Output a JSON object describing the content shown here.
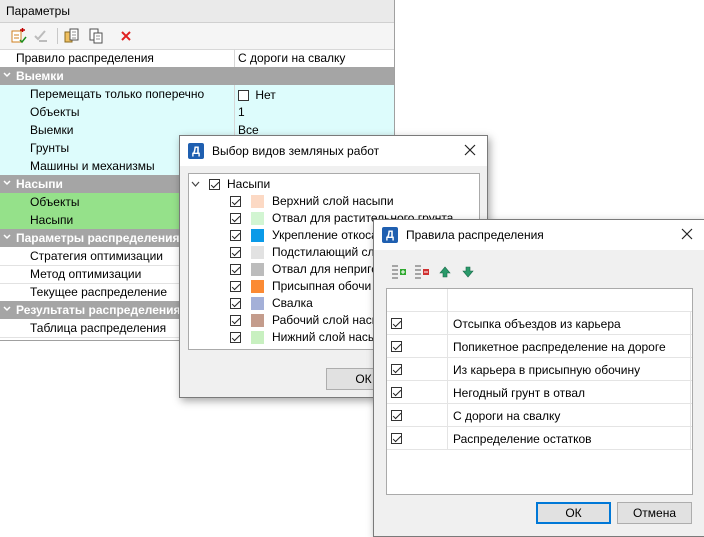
{
  "params": {
    "title": "Параметры",
    "toolbar": {
      "icons": [
        "add-rule-icon",
        "check-rule-icon",
        "copy-icon",
        "paste-icon",
        "delete-icon"
      ],
      "delete_color": "#e02020"
    },
    "top_row": {
      "name": "Правило распределения",
      "value": "С дороги на свалку"
    },
    "sections": [
      {
        "title": "Выемки",
        "rows": [
          {
            "name": "Перемещать только поперечно",
            "value": "Нет",
            "checkbox": true,
            "checked": false
          },
          {
            "name": "Объекты",
            "value": "1"
          },
          {
            "name": "Выемки",
            "value": "Все"
          },
          {
            "name": "Грунты",
            "value": ""
          },
          {
            "name": "Машины и механизмы",
            "value": ""
          }
        ]
      },
      {
        "title": "Насыпи",
        "rows": [
          {
            "name": "Объекты",
            "value": ""
          },
          {
            "name": "Насыпи",
            "value": ""
          }
        ]
      },
      {
        "title": "Параметры распределения",
        "rows": [
          {
            "name": "Стратегия оптимизации",
            "value": ""
          },
          {
            "name": "Метод оптимизации",
            "value": ""
          },
          {
            "name": "Текущее распределение",
            "value": ""
          }
        ]
      },
      {
        "title": "Результаты распределения",
        "rows": [
          {
            "name": "Таблица распределения",
            "value": ""
          }
        ]
      }
    ],
    "colors": {
      "category": "#a5a5a5",
      "cyan": "#ddfcfc",
      "green": "#95e18a"
    }
  },
  "earthworks_dialog": {
    "app_icon_letter": "Д",
    "title": "Выбор видов земляных работ",
    "root": {
      "label": "Насыпи",
      "checked": true
    },
    "items": [
      {
        "label": "Верхний слой насыпи",
        "color": "#fcd9c4",
        "checked": true
      },
      {
        "label": "Отвал для растительного грунта",
        "color": "#d2f5d2",
        "checked": true
      },
      {
        "label": "Укрепление откоса",
        "color": "#0a9ae8",
        "checked": true
      },
      {
        "label": "Подстилающий сл",
        "color": "#e2e2e2",
        "checked": true
      },
      {
        "label": "Отвал для непригс",
        "color": "#bcbcbc",
        "checked": true
      },
      {
        "label": "Присыпная обочи",
        "color": "#fb8a34",
        "checked": true
      },
      {
        "label": "Свалка",
        "color": "#a4b0d8",
        "checked": true
      },
      {
        "label": "Рабочий слой насы",
        "color": "#c49c8c",
        "checked": true
      },
      {
        "label": "Нижний слой насы",
        "color": "#c8f0c0",
        "checked": true
      }
    ],
    "ok_label": "ОК"
  },
  "rules_dialog": {
    "app_icon_letter": "Д",
    "title": "Правила распределения",
    "toolbar_icons": [
      "add-row-icon",
      "remove-row-icon",
      "move-up-icon",
      "move-down-icon"
    ],
    "rules": [
      {
        "label": "Отсыпка объездов из карьера",
        "checked": true
      },
      {
        "label": "Попикетное распределение на дороге",
        "checked": true
      },
      {
        "label": "Из карьера в присыпную обочину",
        "checked": true
      },
      {
        "label": "Негодный грунт в отвал",
        "checked": true
      },
      {
        "label": "С дороги на свалку",
        "checked": true
      },
      {
        "label": "Распределение остатков",
        "checked": true
      }
    ],
    "ok_label": "ОК",
    "cancel_label": "Отмена"
  }
}
